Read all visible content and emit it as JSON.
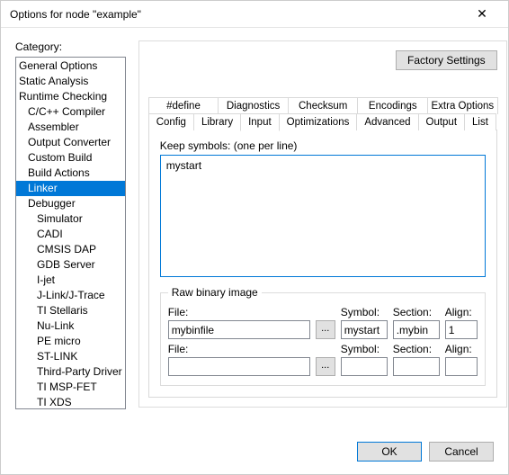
{
  "window": {
    "title": "Options for node \"example\""
  },
  "category_label": "Category:",
  "categories": [
    {
      "label": "General Options",
      "indent": 0
    },
    {
      "label": "Static Analysis",
      "indent": 0
    },
    {
      "label": "Runtime Checking",
      "indent": 0
    },
    {
      "label": "C/C++ Compiler",
      "indent": 1
    },
    {
      "label": "Assembler",
      "indent": 1
    },
    {
      "label": "Output Converter",
      "indent": 1
    },
    {
      "label": "Custom Build",
      "indent": 1
    },
    {
      "label": "Build Actions",
      "indent": 1
    },
    {
      "label": "Linker",
      "indent": 1,
      "selected": true
    },
    {
      "label": "Debugger",
      "indent": 1
    },
    {
      "label": "Simulator",
      "indent": 2
    },
    {
      "label": "CADI",
      "indent": 2
    },
    {
      "label": "CMSIS DAP",
      "indent": 2
    },
    {
      "label": "GDB Server",
      "indent": 2
    },
    {
      "label": "I-jet",
      "indent": 2
    },
    {
      "label": "J-Link/J-Trace",
      "indent": 2
    },
    {
      "label": "TI Stellaris",
      "indent": 2
    },
    {
      "label": "Nu-Link",
      "indent": 2
    },
    {
      "label": "PE micro",
      "indent": 2
    },
    {
      "label": "ST-LINK",
      "indent": 2
    },
    {
      "label": "Third-Party Driver",
      "indent": 2
    },
    {
      "label": "TI MSP-FET",
      "indent": 2
    },
    {
      "label": "TI XDS",
      "indent": 2
    }
  ],
  "factory_settings": "Factory Settings",
  "tabs_row1": [
    "#define",
    "Diagnostics",
    "Checksum",
    "Encodings",
    "Extra Options"
  ],
  "tabs_row2": [
    "Config",
    "Library",
    "Input",
    "Optimizations",
    "Advanced",
    "Output",
    "List"
  ],
  "active_tab": "Input",
  "keep_symbols_label": "Keep symbols: (one per line)",
  "keep_symbols_value": "mystart",
  "raw": {
    "legend": "Raw binary image",
    "labels": {
      "file": "File:",
      "symbol": "Symbol:",
      "section": "Section:",
      "align": "Align:"
    },
    "rows": [
      {
        "file": "mybinfile",
        "symbol": "mystart",
        "section": ".mybin",
        "align": "1"
      },
      {
        "file": "",
        "symbol": "",
        "section": "",
        "align": ""
      }
    ],
    "browse": "..."
  },
  "buttons": {
    "ok": "OK",
    "cancel": "Cancel"
  }
}
